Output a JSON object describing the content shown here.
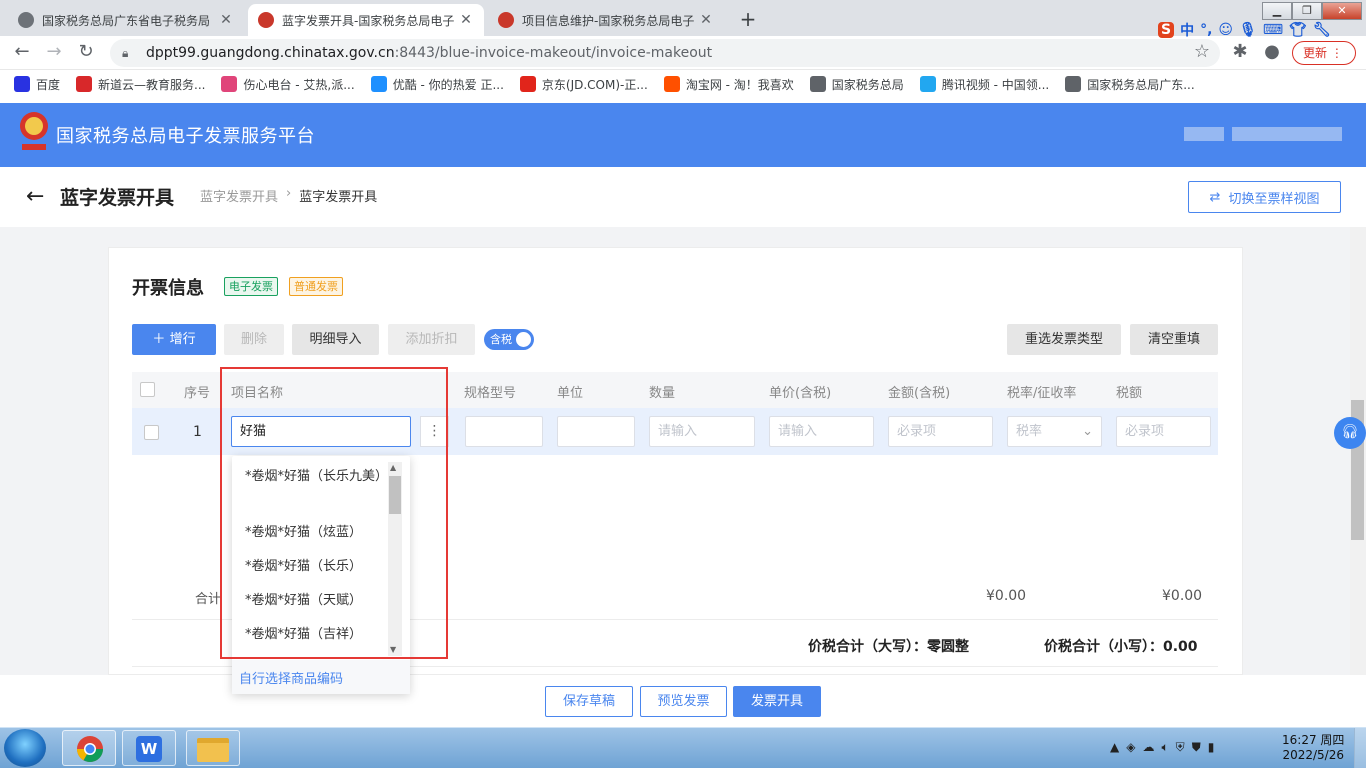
{
  "browser": {
    "tabs": [
      {
        "title": "国家税务总局广东省电子税务局",
        "active": false
      },
      {
        "title": "蓝字发票开具-国家税务总局电子",
        "active": true
      },
      {
        "title": "项目信息维护-国家税务总局电子",
        "active": false
      }
    ],
    "new_tab": "+",
    "url_host": "dppt99.guangdong.chinatax.gov.cn",
    "url_path": ":8443/blue-invoice-makeout/invoice-makeout",
    "update_label": "更新",
    "ime_label": "中"
  },
  "bookmarks": [
    {
      "label": "百度",
      "icon": "baidu-icon",
      "color": "#2932e1"
    },
    {
      "label": "新道云—教育服务...",
      "icon": "xindao-icon",
      "color": "#d8282a"
    },
    {
      "label": "伤心电台 - 艾热,派...",
      "icon": "radio-icon",
      "color": "#e0457a"
    },
    {
      "label": "优酷 - 你的热爱 正...",
      "icon": "youku-icon",
      "color": "#1e90ff"
    },
    {
      "label": "京东(JD.COM)-正...",
      "icon": "jd-icon",
      "color": "#e1251b"
    },
    {
      "label": "淘宝网 - 淘！我喜欢",
      "icon": "taobao-icon",
      "color": "#ff5000"
    },
    {
      "label": "国家税务总局",
      "icon": "globe-icon",
      "color": "#5f6368"
    },
    {
      "label": "腾讯视频 - 中国领...",
      "icon": "tencent-video-icon",
      "color": "#22a7f0"
    },
    {
      "label": "国家税务总局广东...",
      "icon": "globe-icon",
      "color": "#5f6368"
    }
  ],
  "header": {
    "site_title": "国家税务总局电子发票服务平台",
    "color": "#4a86ee"
  },
  "page": {
    "title": "蓝字发票开具",
    "breadcrumb": [
      "蓝字发票开具",
      "蓝字发票开具"
    ],
    "switch_button": "切换至票样视图"
  },
  "section": {
    "title": "开票信息",
    "tags": [
      {
        "label": "电子发票",
        "color": "#19a15f"
      },
      {
        "label": "普通发票",
        "color": "#f0a020"
      }
    ]
  },
  "actions": {
    "add_row": "增行",
    "delete": "删除",
    "import_detail": "明细导入",
    "add_discount": "添加折扣",
    "tax_toggle": "含税",
    "reselect_type": "重选发票类型",
    "clear": "清空重填"
  },
  "table": {
    "columns": [
      "序号",
      "项目名称",
      "规格型号",
      "单位",
      "数量",
      "单价(含税)",
      "金额(含税)",
      "税率/征收率",
      "税额"
    ],
    "rows": [
      {
        "index": "1",
        "item_name": "好猫",
        "spec": "",
        "unit": "",
        "quantity_placeholder": "请输入",
        "price_placeholder": "请输入",
        "amount_placeholder": "必录项",
        "tax_rate_placeholder": "税率",
        "tax_placeholder": "必录项"
      }
    ]
  },
  "autocomplete": {
    "options": [
      "*卷烟*好猫（长乐九美）",
      "*卷烟*好猫（炫蓝）",
      "*卷烟*好猫（长乐）",
      "*卷烟*好猫（天赋）",
      "*卷烟*好猫（吉祥）"
    ],
    "footer_link": "自行选择商品编码"
  },
  "totals": {
    "label": "合计",
    "amount": "¥0.00",
    "tax": "¥0.00",
    "total_upper_label": "价税合计（大写）：",
    "total_upper_value": "零圆整",
    "total_lower_label": "价税合计（小写）：",
    "total_lower_value": "0.00"
  },
  "bottom_actions": {
    "save_draft": "保存草稿",
    "preview": "预览发票",
    "issue": "发票开具"
  },
  "taskbar": {
    "time": "16:27 周四",
    "date": "2022/5/26"
  }
}
